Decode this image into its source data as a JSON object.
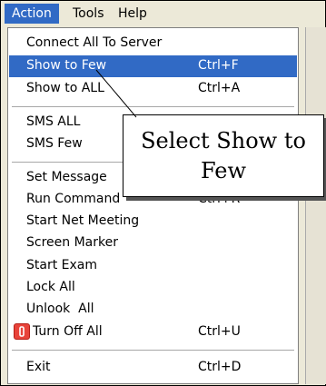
{
  "menubar": {
    "items": [
      "Action",
      "Tools",
      "Help"
    ]
  },
  "menu": {
    "items": [
      {
        "label": "Connect All To Server",
        "shortcut": ""
      },
      {
        "label": "Show to Few",
        "shortcut": "Ctrl+F"
      },
      {
        "label": "Show to ALL",
        "shortcut": "Ctrl+A"
      },
      {
        "label": "SMS ALL",
        "shortcut": ""
      },
      {
        "label": "SMS Few",
        "shortcut": ""
      },
      {
        "label": "Set Message",
        "shortcut": ""
      },
      {
        "label": "Run Command",
        "shortcut": "Ctrl+R"
      },
      {
        "label": "Start Net Meeting",
        "shortcut": ""
      },
      {
        "label": "Screen Marker",
        "shortcut": ""
      },
      {
        "label": "Start Exam",
        "shortcut": ""
      },
      {
        "label": "Lock All",
        "shortcut": ""
      },
      {
        "label": "Unlook  All",
        "shortcut": ""
      },
      {
        "label": "Turn Off All",
        "shortcut": "Ctrl+U"
      },
      {
        "label": "Exit",
        "shortcut": "Ctrl+D"
      }
    ],
    "highlight_color": "#316ac5"
  },
  "callout": {
    "text": "Select Show to Few"
  },
  "icons": {
    "turn_off_all": "power-icon"
  }
}
